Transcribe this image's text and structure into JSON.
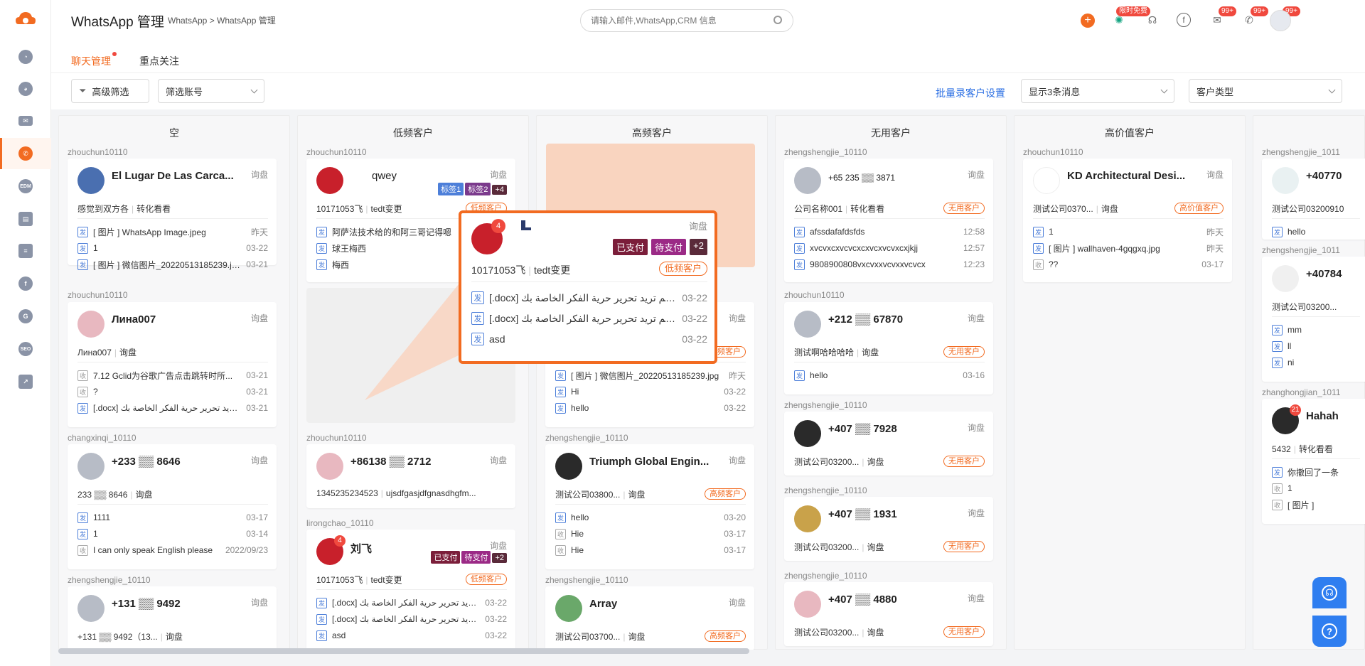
{
  "app": {
    "title": "WhatsApp 管理",
    "breadcrumb": "WhatsApp > WhatsApp 管理"
  },
  "search": {
    "placeholder": "请输入邮件,WhatsApp,CRM 信息"
  },
  "header": {
    "free_badge": "限时免费",
    "badge_99": "99+"
  },
  "sidebar": {
    "items": [
      "dashboard",
      "analytics",
      "mail",
      "whatsapp",
      "edm",
      "docs",
      "forms",
      "facebook",
      "google",
      "seo",
      "reports"
    ],
    "edm_label": "EDM",
    "seo_label": "SEO",
    "g_label": "G",
    "f_label": "f"
  },
  "tabs": {
    "chat": "聊天管理",
    "focus": "重点关注"
  },
  "toolbar": {
    "filter": "高级筛选",
    "account": "筛选账号",
    "batch": "批量录客户设置",
    "show_msgs": "显示3条消息",
    "customer_type": "客户类型"
  },
  "labels": {
    "send": "发",
    "recv": "收",
    "ask": "询盘"
  },
  "columns": [
    {
      "title": "空",
      "cards": [
        {
          "owner": "zhouchun10110",
          "name": "El Lugar De Las Carca...",
          "info": [
            "感觉到双方各",
            "转化看看"
          ],
          "msgs": [
            [
              "发",
              "[ 图片 ] WhatsApp Image.jpeg",
              "昨天"
            ],
            [
              "发",
              "1",
              "03-22"
            ],
            [
              "发",
              "[ 图片 ] 微信图片_20220513185239.jpg",
              "03-21"
            ]
          ]
        },
        {
          "owner": "zhouchun10110",
          "name": "Лина007",
          "info": [
            "Лина007",
            "询盘"
          ],
          "msgs": [
            [
              "收",
              "7.12 Gclid为谷歌广告点击跳转时所...",
              "03-21"
            ],
            [
              "收",
              "?",
              "03-21"
            ],
            [
              "发",
              "[.docx] يمكم تريد تحرير حرية الفكر الخاصة بك",
              "03-21"
            ]
          ]
        },
        {
          "owner": "changxinqi_10110",
          "name": "+233 ▒▒ 8646",
          "info": [
            "233 ▒▒ 8646",
            "询盘"
          ],
          "msgs": [
            [
              "发",
              "1111",
              "03-17"
            ],
            [
              "发",
              "1",
              "03-14"
            ],
            [
              "收",
              "I can only speak English please",
              "2022/09/23"
            ]
          ]
        },
        {
          "owner": "zhengshengjie_10110",
          "name": "+131 ▒▒ 9492",
          "info": [
            "+131 ▒▒ 9492（13...",
            "询盘"
          ],
          "msgs": []
        }
      ]
    },
    {
      "title": "低频客户",
      "cards": [
        {
          "owner": "zhouchun10110",
          "name": "qwey",
          "info": [
            "10171053飞",
            "tedt变更"
          ],
          "tag": "低频客户",
          "chips": [
            "标签1",
            "标签2",
            "+4"
          ],
          "msgs": [
            [
              "发",
              "阿萨法技术给的和阿三哥记得嗯",
              ""
            ],
            [
              "发",
              "球王梅西",
              ""
            ],
            [
              "发",
              "梅西",
              ""
            ]
          ]
        },
        {
          "owner": "zhouchun10110",
          "name": "+86138 ▒▒ 2712",
          "info": [
            "1345235234523",
            "ujsdfgasjdfgnasdhgfm..."
          ],
          "msgs": []
        },
        {
          "owner": "lirongchao_10110",
          "name": "刘飞",
          "info": [
            "10171053飞",
            "tedt变更"
          ],
          "tag": "低频客户",
          "chips": [
            "已支付",
            "待支付",
            "+2"
          ],
          "msgs": [
            [
              "发",
              "[.docx] يمكم تريد تحرير حرية الفكر الخاصة بك",
              "03-22"
            ],
            [
              "发",
              "[.docx] يمكم تريد تحرير حرية الفكر الخاصة بك",
              "03-22"
            ],
            [
              "发",
              "asd",
              "03-22"
            ]
          ]
        }
      ]
    },
    {
      "title": "高频客户",
      "cards": [
        {
          "owner": "",
          "name": "",
          "info": [
            "",
            ""
          ],
          "tag": "高频客户",
          "msgs": [
            [
              "发",
              "[ 图片 ] 微信图片_20220513185239.jpg",
              "昨天"
            ],
            [
              "发",
              "Hi",
              "03-22"
            ],
            [
              "发",
              "hello",
              "03-22"
            ]
          ]
        },
        {
          "owner": "zhengshengjie_10110",
          "name": "Triumph Global Engin...",
          "info": [
            "测试公司03800...",
            "询盘"
          ],
          "tag": "高频客户",
          "msgs": [
            [
              "发",
              "hello",
              "03-20"
            ],
            [
              "收",
              "Hie",
              "03-17"
            ],
            [
              "收",
              "Hie",
              "03-17"
            ]
          ]
        },
        {
          "owner": "zhengshengjie_10110",
          "name": "Array",
          "info": [
            "测试公司03700...",
            "询盘"
          ],
          "tag": "高频客户",
          "msgs": []
        }
      ]
    },
    {
      "title": "无用客户",
      "cards": [
        {
          "owner": "zhengshengjie_10110",
          "name": "+65 235 ▒▒ 3871",
          "info": [
            "公司名称001",
            "转化看看"
          ],
          "tag": "无用客户",
          "msgs": [
            [
              "发",
              "afssdafafdsfds",
              "12:58"
            ],
            [
              "发",
              "xvcvxcxvcvcxcxvcxvcvxcxjkjj",
              "12:57"
            ],
            [
              "发",
              "9808900808vxcvxxvcvxxvcvcx",
              "12:23"
            ]
          ]
        },
        {
          "owner": "zhouchun10110",
          "name": "+212 ▒▒ 67870",
          "info": [
            "测试啊哈哈哈哈",
            "询盘"
          ],
          "tag": "无用客户",
          "msgs": [
            [
              "发",
              "hello",
              "03-16"
            ]
          ]
        },
        {
          "owner": "zhengshengjie_10110",
          "name": "+407 ▒▒ 7928",
          "info": [
            "测试公司03200...",
            "询盘"
          ],
          "tag": "无用客户",
          "msgs": []
        },
        {
          "owner": "zhengshengjie_10110",
          "name": "+407 ▒▒ 1931",
          "info": [
            "测试公司03200...",
            "询盘"
          ],
          "tag": "无用客户",
          "msgs": []
        },
        {
          "owner": "zhengshengjie_10110",
          "name": "+407 ▒▒ 4880",
          "info": [
            "测试公司03200...",
            "询盘"
          ],
          "tag": "无用客户",
          "msgs": []
        }
      ]
    },
    {
      "title": "高价值客户",
      "cards": [
        {
          "owner": "zhouchun10110",
          "name": "KD Architectural Desi...",
          "info": [
            "测试公司0370...",
            "询盘"
          ],
          "tag": "高价值客户",
          "msgs": [
            [
              "发",
              "1",
              "昨天"
            ],
            [
              "发",
              "[ 图片 ] wallhaven-4gqgxq.jpg",
              "昨天"
            ],
            [
              "收",
              "??",
              "03-17"
            ]
          ]
        }
      ]
    },
    {
      "title": "",
      "cards": [
        {
          "owner": "zhengshengjie_1011",
          "name": "+40770",
          "info": [
            "测试公司03200910",
            ""
          ],
          "msgs": [
            [
              "发",
              "hello",
              ""
            ]
          ]
        },
        {
          "owner": "zhengshengjie_1011",
          "name": "+40784",
          "info": [
            "测试公司03200...",
            ""
          ],
          "msgs": [
            [
              "发",
              "mm",
              ""
            ],
            [
              "发",
              "ll",
              ""
            ],
            [
              "发",
              "ni",
              ""
            ]
          ]
        },
        {
          "owner": "zhanghongjian_1011",
          "name": "Hahah",
          "info": [
            "5432",
            "转化看看"
          ],
          "badge": "21",
          "msgs": [
            [
              "发",
              "你撤回了一条",
              ""
            ],
            [
              "收",
              "1",
              ""
            ],
            [
              "收",
              "[ 图片 ]",
              ""
            ]
          ]
        }
      ]
    }
  ],
  "popup": {
    "ask": "询盘",
    "badge": "4",
    "chips": [
      "已支付",
      "待支付",
      "+2"
    ],
    "info": [
      "10171053飞",
      "tedt变更"
    ],
    "tag": "低频客户",
    "msgs": [
      [
        "发",
        "[.docx] يمكم تريد تحرير حرية الفكر الخاصة بك",
        "03-22"
      ],
      [
        "发",
        "[.docx] يمكم تريد تحرير حرية الفكر الخاصة بك",
        "03-22"
      ],
      [
        "发",
        "asd",
        "03-22"
      ]
    ]
  },
  "colors": {
    "accent": "#f26b21",
    "link": "#2b6fe3",
    "chip_dark": "#7b1e3a",
    "chip_purple": "#9b2a86",
    "chip_blue": "#4d7fd9"
  }
}
